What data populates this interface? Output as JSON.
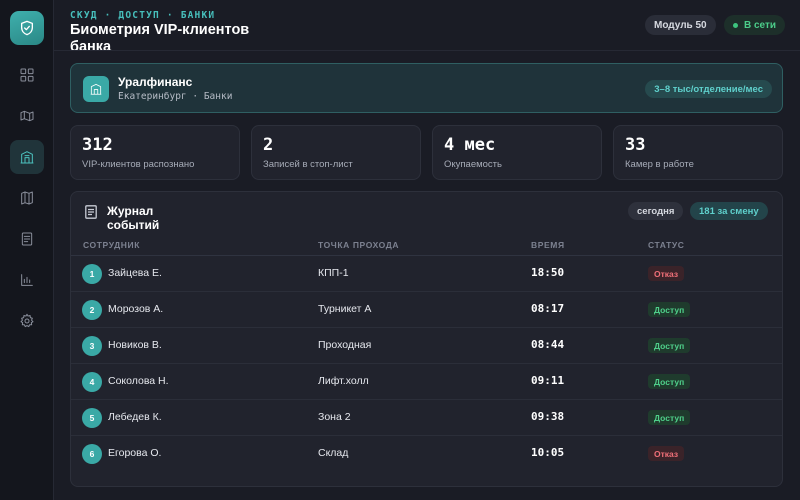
{
  "header": {
    "breadcrumb": "СКУД · ДОСТУП · БАНКИ",
    "title": "Биометрия VIP-клиентов банка",
    "module": "Модуль 50",
    "online": "В сети"
  },
  "sidebar": {
    "items": [
      {
        "icon": "dashboard-icon"
      },
      {
        "icon": "map-icon"
      },
      {
        "icon": "bank-icon",
        "active": true
      },
      {
        "icon": "book-map-icon"
      },
      {
        "icon": "document-icon"
      },
      {
        "icon": "chart-icon"
      },
      {
        "icon": "gear-icon"
      }
    ]
  },
  "org": {
    "name": "Уралфинанс",
    "city": "Екатеринбург",
    "sector": "Банки",
    "badge": "3–8 тыс/отделение/мес"
  },
  "stats": [
    {
      "value": "312",
      "label": "VIP-клиентов распознано"
    },
    {
      "value": "2",
      "label": "Записей в стоп-лист"
    },
    {
      "value": "4 мес",
      "label": "Окупаемость"
    },
    {
      "value": "33",
      "label": "Камер в работе"
    }
  ],
  "journal": {
    "title": "Журнал событий",
    "today": "сегодня",
    "shift": "181 за смену",
    "columns": [
      "СОТРУДНИК",
      "ТОЧКА ПРОХОДА",
      "ВРЕМЯ",
      "СТАТУС"
    ],
    "rows": [
      {
        "num": "1",
        "name": "Зайцева Е.",
        "point": "КПП-1",
        "time": "18:50",
        "status": "Отказ"
      },
      {
        "num": "2",
        "name": "Морозов А.",
        "point": "Турникет А",
        "time": "08:17",
        "status": "Доступ"
      },
      {
        "num": "3",
        "name": "Новиков В.",
        "point": "Проходная",
        "time": "08:44",
        "status": "Доступ"
      },
      {
        "num": "4",
        "name": "Соколова Н.",
        "point": "Лифт.холл",
        "time": "09:11",
        "status": "Доступ"
      },
      {
        "num": "5",
        "name": "Лебедев К.",
        "point": "Зона 2",
        "time": "09:38",
        "status": "Доступ"
      },
      {
        "num": "6",
        "name": "Егорова О.",
        "point": "Склад",
        "time": "10:05",
        "status": "Отказ"
      }
    ]
  },
  "colors": {
    "accent": "#3aa9a6",
    "allow": "#4fd08a",
    "deny": "#ef6f78"
  }
}
